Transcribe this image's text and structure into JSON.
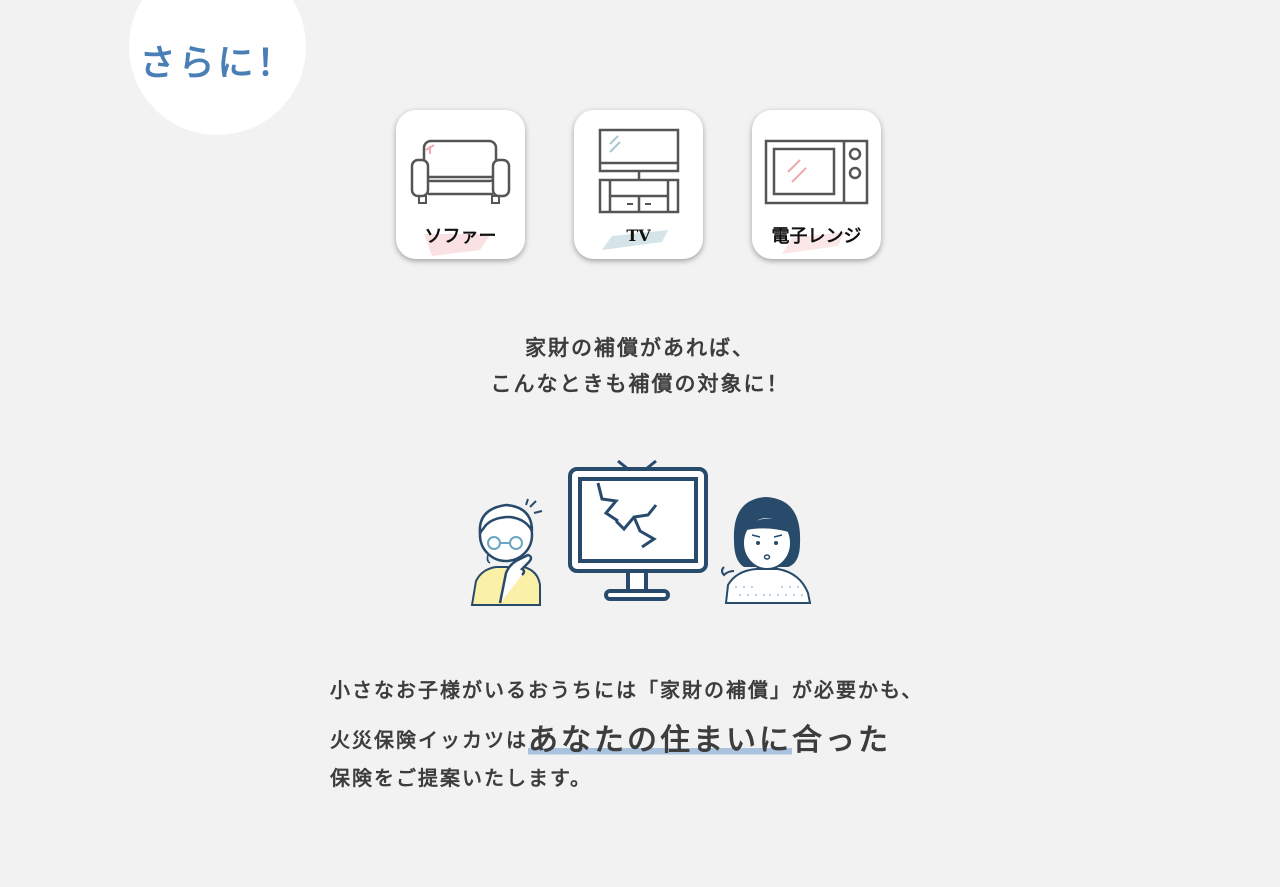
{
  "badge": {
    "text": "さらに！"
  },
  "cards": [
    {
      "label": "ソファー",
      "icon": "sofa-icon"
    },
    {
      "label": "TV",
      "icon": "tv-icon"
    },
    {
      "label": "電子レンジ",
      "icon": "microwave-icon"
    }
  ],
  "lead": {
    "line1": "家財の補償があれば、",
    "line2": "こんなときも補償の対象に！"
  },
  "illustration": {
    "icon": "broken-tv-people-illustration"
  },
  "body": {
    "line1": "小さなお子様がいるおうちには「家財の補償」が必要かも、",
    "line2_prefix": "火災保険イッカツは",
    "line2_highlight": "あなたの住まいに",
    "line2_suffix": "合った",
    "line3": "保険をご提案いたします。"
  },
  "colors": {
    "background": "#f2f2f2",
    "accent_blue": "#4a7fb5",
    "navy": "#284a6b",
    "highlight": "#a9c3de",
    "text": "#3d3d3d"
  }
}
